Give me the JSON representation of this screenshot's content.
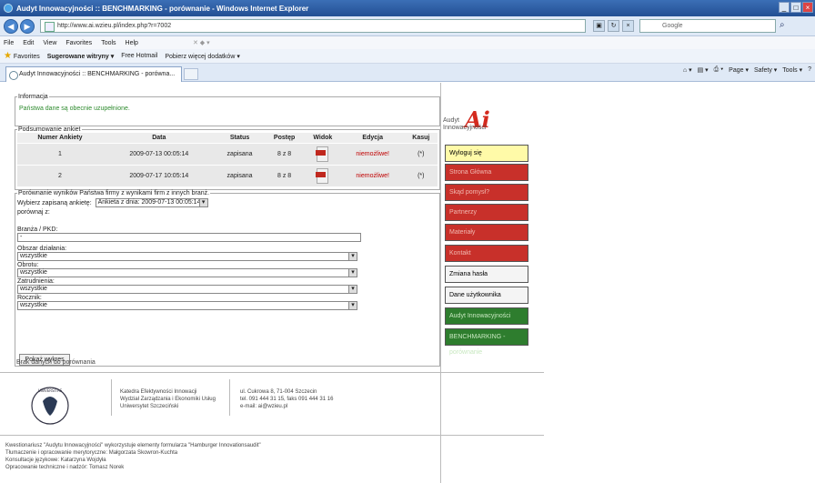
{
  "window": {
    "title": "Audyt Innowacyjności :: BENCHMARKING - porównanie - Windows Internet Explorer"
  },
  "address": {
    "url": "http://www.ai.wzieu.pl/index.php?r=7002",
    "search_placeholder": "Google"
  },
  "menu": [
    "File",
    "Edit",
    "View",
    "Favorites",
    "Tools",
    "Help"
  ],
  "favorites": {
    "label": "Favorites",
    "items": [
      "Sugerowane witryny ▾",
      "Free Hotmail",
      "Pobierz więcej dodatków ▾"
    ]
  },
  "tab": {
    "label": "Audyt Innowacyjności :: BENCHMARKING - porówna..."
  },
  "commandbar": [
    "Page ▾",
    "Safety ▾",
    "Tools ▾"
  ],
  "info": {
    "legend": "Informacja",
    "message": "Państwa dane są obecnie uzupełnione."
  },
  "surveys": {
    "legend": "Podsumowanie ankiet",
    "columns": [
      "Numer Ankiety",
      "Data",
      "Status",
      "Postęp",
      "Widok",
      "Edycja",
      "Kasuj"
    ],
    "rows": [
      [
        "1",
        "2009-07-13 00:05:14",
        "zapisana",
        "8 z 8",
        "",
        "niemożliwe!",
        "(*)"
      ],
      [
        "2",
        "2009-07-17 10:05:14",
        "zapisana",
        "8 z 8",
        "",
        "niemożliwe!",
        "(*)"
      ]
    ]
  },
  "compare": {
    "legend": "Porównanie wyników Państwa firmy z wynikami firm z innych branż.",
    "choose_label": "Wybierz zapisaną ankietę:",
    "choose_value": "Ankieta z dnia: 2009-07-13 00:05:14",
    "compare_with": "porównaj z:",
    "fields": [
      {
        "label": "Branża / PKD:",
        "value": "-"
      },
      {
        "label": "Obszar działania:",
        "value": "wszystkie"
      },
      {
        "label": "Obrotu:",
        "value": "wszystkie"
      },
      {
        "label": "Zatrudnienia:",
        "value": "wszystkie"
      },
      {
        "label": "Rocznik:",
        "value": "wszystkie"
      }
    ],
    "button": "Pokaż wykres"
  },
  "nodata": "Brak danych do porównania",
  "footer": {
    "col1": [
      "Katedra Efektywności Innowacji",
      "Wydział Zarządzania i Ekonomiki Usług",
      "Uniwersytet Szczeciński"
    ],
    "col2": [
      "ul. Cukrowa 8, 71-004 Szczecin",
      "tel. 091 444 31 15, faks 091 444 31 16",
      "e-mail: ai@wzieu.pl"
    ],
    "credits": [
      "Kwestionariusz \"Audytu Innowacyjności\" wykorzystuje elementy formularza \"Hamburger Innovationsaudit\"",
      "Tłumaczenie i opracowanie merytoryczne: Małgorzata Skowron-Kuchta",
      "Konsultacje językowe: Katarzyna Wojdyła",
      "Opracowanie techniczne i nadzór: Tomasz Norek"
    ]
  },
  "logo": {
    "letters": "Ai",
    "line1": "Audyt",
    "line2": "Innowacyjności"
  },
  "side_menu": [
    {
      "label": "Wyloguj się",
      "style": "yellow"
    },
    {
      "label": "Strona Główna",
      "style": "red"
    },
    {
      "label": "Skąd pomysł?",
      "style": "red"
    },
    {
      "label": "Partnerzy",
      "style": "red"
    },
    {
      "label": "Materiały",
      "style": "red"
    },
    {
      "label": "Kontakt",
      "style": "red"
    },
    {
      "label": "Zmiana hasła",
      "style": "white"
    },
    {
      "label": "Dane użytkownika",
      "style": "white"
    },
    {
      "label": "Audyt Innowacyjności",
      "style": "green"
    },
    {
      "label": "BENCHMARKING - porównanie",
      "style": "green"
    }
  ]
}
